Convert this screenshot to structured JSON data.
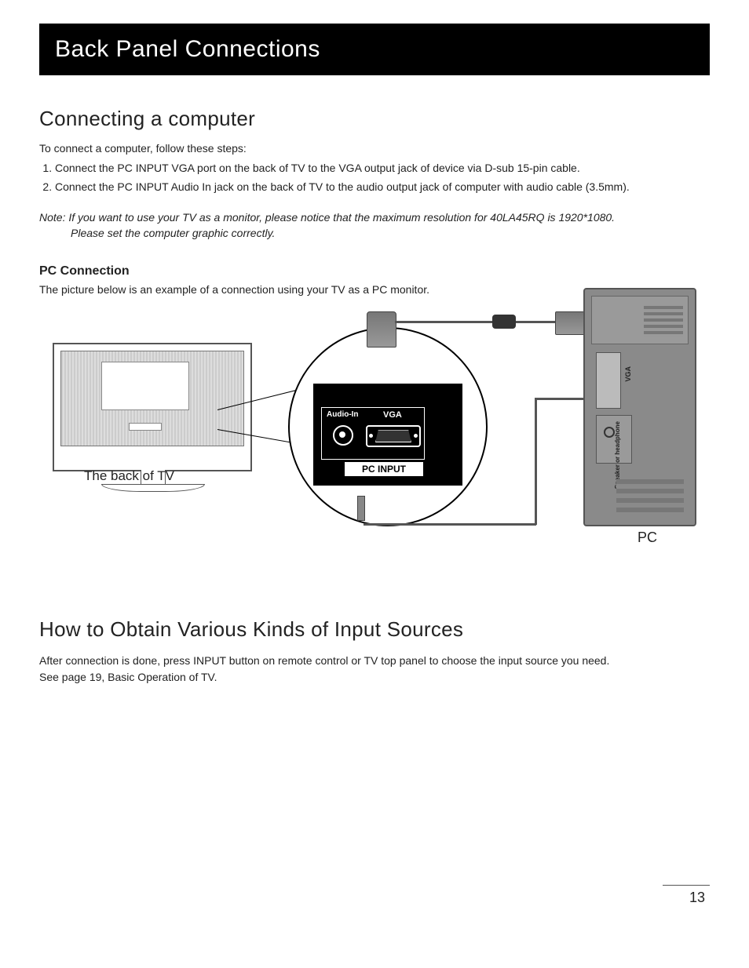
{
  "banner": "Back Panel Connections",
  "section1": {
    "title": "Connecting a computer",
    "intro": "To  connect a computer, follow these steps:",
    "steps": [
      "Connect the PC INPUT VGA port on the back of TV to the VGA output jack of device via D-sub 15-pin cable.",
      "Connect the PC INPUT Audio In jack on the back of TV to the audio output jack of computer with audio cable (3.5mm)."
    ],
    "note_line1": "Note: If you want to use your TV as a monitor, please notice that the maximum resolution for 40LA45RQ is 1920*1080.",
    "note_line2": "Please set the computer graphic correctly."
  },
  "pcconn": {
    "heading": "PC Connection",
    "caption": "The picture below is an example of a connection using your TV as a PC monitor."
  },
  "diagram": {
    "tv_label": "The back of TV",
    "pc_label": "PC",
    "panel_audio": "Audio-In",
    "panel_vga": "VGA",
    "panel_input": "PC INPUT",
    "pc_vga": "VGA",
    "pc_audio": "Speaker or\nheadphone"
  },
  "section2": {
    "title": "How to Obtain Various Kinds of Input Sources",
    "body1": "After connection is done, press INPUT button on remote control or TV top panel to choose the input source you need.",
    "body2": "See page 19, Basic Operation of TV."
  },
  "page_number": "13"
}
